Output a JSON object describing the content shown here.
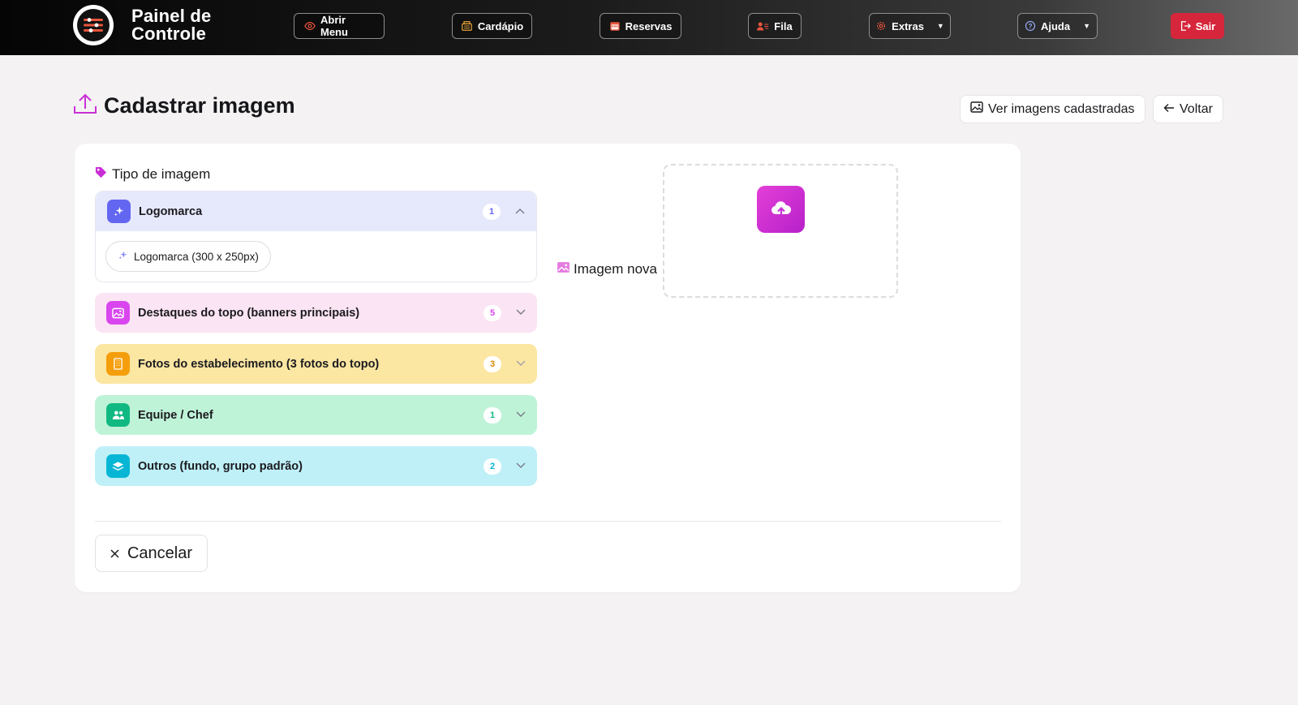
{
  "navbar": {
    "brand_title": "Painel de Controle",
    "items": [
      {
        "label": "Abrir Menu",
        "icon": "eye-icon"
      },
      {
        "label": "Cardápio",
        "icon": "menu-book-icon"
      },
      {
        "label": "Reservas",
        "icon": "calendar-icon"
      },
      {
        "label": "Fila",
        "icon": "people-queue-icon"
      },
      {
        "label": "Extras",
        "icon": "gear-icon",
        "dropdown": true
      },
      {
        "label": "Ajuda",
        "icon": "help-circle-icon",
        "dropdown": true
      },
      {
        "label": "Sair",
        "icon": "logout-icon"
      }
    ],
    "sair_color": "#d6263b"
  },
  "header": {
    "title": "Cadastrar imagem",
    "view_images_label": "Ver imagens cadastradas",
    "back_label": "Voltar"
  },
  "form": {
    "type_label": "Tipo de imagem",
    "groups": [
      {
        "label": "Logomarca",
        "count": "1",
        "expanded": true,
        "color": "#6366f1",
        "bg": "#e6e8fb",
        "options": [
          "Logomarca (300 x 250px)"
        ]
      },
      {
        "label": "Destaques do topo (banners principais)",
        "count": "5",
        "expanded": false,
        "color": "#d946ef",
        "bg": "#fbe4f3"
      },
      {
        "label": "Fotos do estabelecimento (3 fotos do topo)",
        "count": "3",
        "expanded": false,
        "color": "#f59e0b",
        "bg": "#fbe6a2"
      },
      {
        "label": "Equipe / Chef",
        "count": "1",
        "expanded": false,
        "color": "#10b981",
        "bg": "#bff3d8"
      },
      {
        "label": "Outros (fundo, grupo padrão)",
        "count": "2",
        "expanded": false,
        "color": "#06b6d4",
        "bg": "#bff0f8"
      }
    ],
    "upload_label": "Imagem nova",
    "cancel_label": "Cancelar"
  },
  "colors": {
    "accent": "#c92fd6",
    "page_bg": "#f4f2f3"
  }
}
